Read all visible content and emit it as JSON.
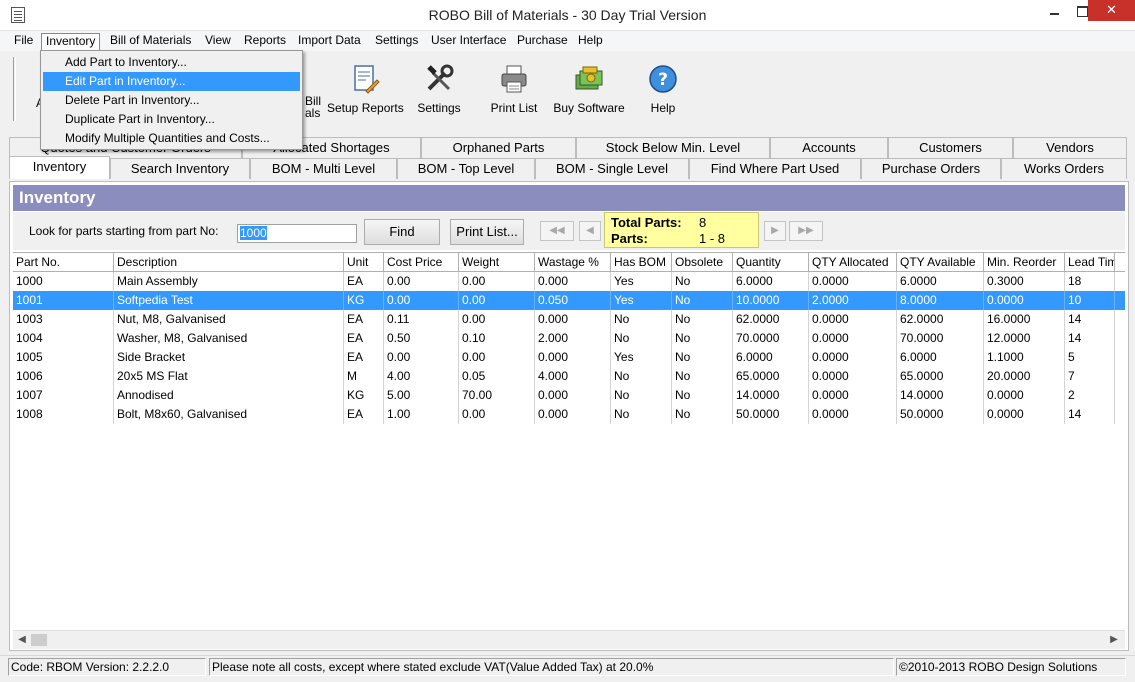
{
  "window": {
    "title": "ROBO Bill of Materials - 30 Day Trial Version"
  },
  "menu": [
    "File",
    "Inventory",
    "Bill of Materials",
    "View",
    "Reports",
    "Import Data",
    "Settings",
    "User Interface",
    "Purchase",
    "Help"
  ],
  "inventory_menu": [
    "Add Part to Inventory...",
    "Edit Part in Inventory...",
    "Delete Part in Inventory...",
    "Duplicate Part in Inventory...",
    "Modify Multiple Quantities and Costs..."
  ],
  "toolbar": {
    "partial_left": "A",
    "partial_bill": "Bill",
    "partial_als": "als",
    "setup_reports": "Setup Reports",
    "settings": "Settings",
    "print_list": "Print List",
    "buy_software": "Buy Software",
    "help": "Help"
  },
  "tabs_top": [
    "Quotes and Customer Orders",
    "Allocated Shortages",
    "Orphaned Parts",
    "Stock Below Min. Level",
    "Accounts",
    "Customers",
    "Vendors"
  ],
  "tabs_bottom": [
    "Inventory",
    "Search Inventory",
    "BOM - Multi Level",
    "BOM - Top Level",
    "BOM - Single Level",
    "Find Where Part Used",
    "Purchase Orders",
    "Works Orders"
  ],
  "panel": {
    "title": "Inventory",
    "search_label": "Look for parts starting from part No:",
    "search_value": "1000",
    "find_button": "Find",
    "print_list_button": "Print List...",
    "nav": [
      "◀◀",
      "◀",
      "▶",
      "▶▶"
    ],
    "total_parts_label": "Total Parts:",
    "total_parts_value": "8",
    "parts_label": "Parts:",
    "parts_value": "1 - 8"
  },
  "grid": {
    "columns": [
      "Part No.",
      "Description",
      "Unit",
      "Cost Price",
      "Weight",
      "Wastage %",
      "Has BOM",
      "Obsolete",
      "Quantity",
      "QTY Allocated",
      "QTY Available",
      "Min. Reorder",
      "Lead Time"
    ],
    "selected_row": 1,
    "rows": [
      [
        "1000",
        "Main Assembly",
        "EA",
        "0.00",
        "0.00",
        "0.000",
        "Yes",
        "No",
        "6.0000",
        "0.0000",
        "6.0000",
        "0.3000",
        "18"
      ],
      [
        "1001",
        "Softpedia Test",
        "KG",
        "0.00",
        "0.00",
        "0.050",
        "Yes",
        "No",
        "10.0000",
        "2.0000",
        "8.0000",
        "0.0000",
        "10"
      ],
      [
        "1003",
        "Nut, M8, Galvanised",
        "EA",
        "0.11",
        "0.00",
        "0.000",
        "No",
        "No",
        "62.0000",
        "0.0000",
        "62.0000",
        "16.0000",
        "14"
      ],
      [
        "1004",
        "Washer, M8, Galvanised",
        "EA",
        "0.50",
        "0.10",
        "2.000",
        "No",
        "No",
        "70.0000",
        "0.0000",
        "70.0000",
        "12.0000",
        "14"
      ],
      [
        "1005",
        "Side Bracket",
        "EA",
        "0.00",
        "0.00",
        "0.000",
        "Yes",
        "No",
        "6.0000",
        "0.0000",
        "6.0000",
        "1.1000",
        "5"
      ],
      [
        "1006",
        "20x5 MS Flat",
        "M",
        "4.00",
        "0.05",
        "4.000",
        "No",
        "No",
        "65.0000",
        "0.0000",
        "65.0000",
        "20.0000",
        "7"
      ],
      [
        "1007",
        "Annodised",
        "KG",
        "5.00",
        "70.00",
        "0.000",
        "No",
        "No",
        "14.0000",
        "0.0000",
        "14.0000",
        "0.0000",
        "2"
      ],
      [
        "1008",
        "Bolt, M8x60, Galvanised",
        "EA",
        "1.00",
        "0.00",
        "0.000",
        "No",
        "No",
        "50.0000",
        "0.0000",
        "50.0000",
        "0.0000",
        "14"
      ]
    ]
  },
  "status": {
    "version": "Code: RBOM Version: 2.2.2.0",
    "note": "Please note all costs, except where stated exclude VAT(Value Added Tax) at 20.0%",
    "copyright": "©2010-2013 ROBO Design Solutions"
  },
  "colors": {
    "selection": "#3399ff",
    "panel_header": "#8b8dbe",
    "totals_bg": "#ffffa0",
    "close_button": "#c7312a"
  }
}
